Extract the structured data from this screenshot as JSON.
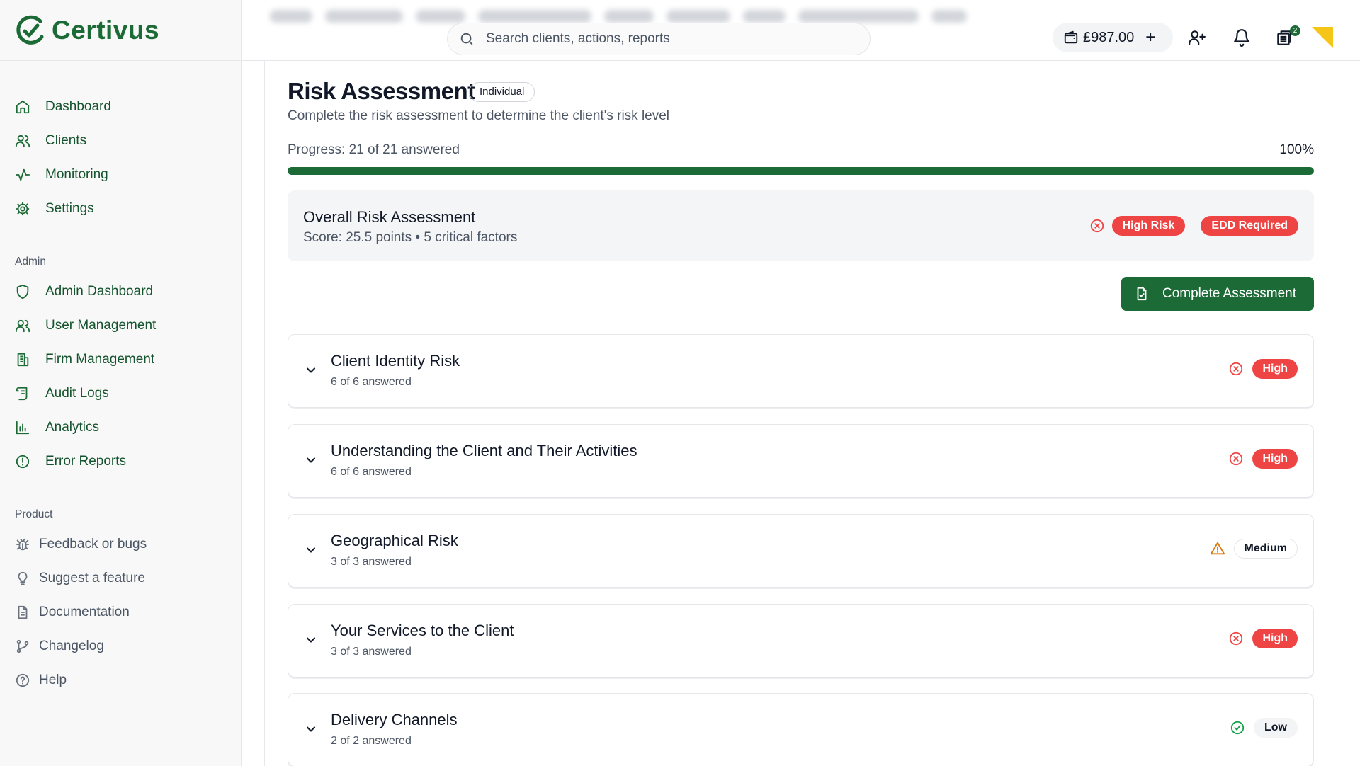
{
  "app": {
    "name": "Certivus",
    "brand_color": "#1c6b37"
  },
  "sidebar": {
    "main_items": [
      {
        "label": "Dashboard",
        "icon": "home-icon"
      },
      {
        "label": "Clients",
        "icon": "users-icon"
      },
      {
        "label": "Monitoring",
        "icon": "activity-icon"
      },
      {
        "label": "Settings",
        "icon": "gear-icon"
      }
    ],
    "admin_label": "Admin",
    "admin_items": [
      {
        "label": "Admin Dashboard",
        "icon": "shield-icon"
      },
      {
        "label": "User Management",
        "icon": "users-icon"
      },
      {
        "label": "Firm Management",
        "icon": "building-icon"
      },
      {
        "label": "Audit Logs",
        "icon": "scroll-icon"
      },
      {
        "label": "Analytics",
        "icon": "bar-chart-icon"
      },
      {
        "label": "Error Reports",
        "icon": "alert-circle-icon"
      }
    ],
    "product_label": "Product",
    "product_items": [
      {
        "label": "Feedback or bugs",
        "icon": "bug-icon"
      },
      {
        "label": "Suggest a feature",
        "icon": "lightbulb-icon"
      },
      {
        "label": "Documentation",
        "icon": "file-text-icon"
      },
      {
        "label": "Changelog",
        "icon": "git-branch-icon"
      },
      {
        "label": "Help",
        "icon": "help-circle-icon"
      }
    ]
  },
  "header": {
    "search_placeholder": "Search clients, actions, reports",
    "balance": "£987.00",
    "notification_count": "2"
  },
  "page": {
    "title": "Risk Assessment",
    "client_type": "Individual",
    "subtitle": "Complete the risk assessment to determine the client's risk level",
    "progress_label": "Progress: 21 of 21 answered",
    "progress_percent_label": "100%",
    "progress_value": 1.0
  },
  "overall": {
    "title": "Overall Risk Assessment",
    "score": "Score: 25.5 points • 5 critical factors",
    "risk_badge": "High Risk",
    "edd_badge": "EDD Required"
  },
  "actions": {
    "complete_label": "Complete Assessment"
  },
  "sections": [
    {
      "title": "Client Identity Risk",
      "count": "6 of 6 answered",
      "risk": "High",
      "level": "high"
    },
    {
      "title": "Understanding the Client and Their Activities",
      "count": "6 of 6 answered",
      "risk": "High",
      "level": "high"
    },
    {
      "title": "Geographical Risk",
      "count": "3 of 3 answered",
      "risk": "Medium",
      "level": "medium"
    },
    {
      "title": "Your Services to the Client",
      "count": "3 of 3 answered",
      "risk": "High",
      "level": "high"
    },
    {
      "title": "Delivery Channels",
      "count": "2 of 2 answered",
      "risk": "Low",
      "level": "low"
    }
  ],
  "colors": {
    "high": "#ef4444",
    "medium": "#d97706",
    "low": "#16a34a"
  }
}
